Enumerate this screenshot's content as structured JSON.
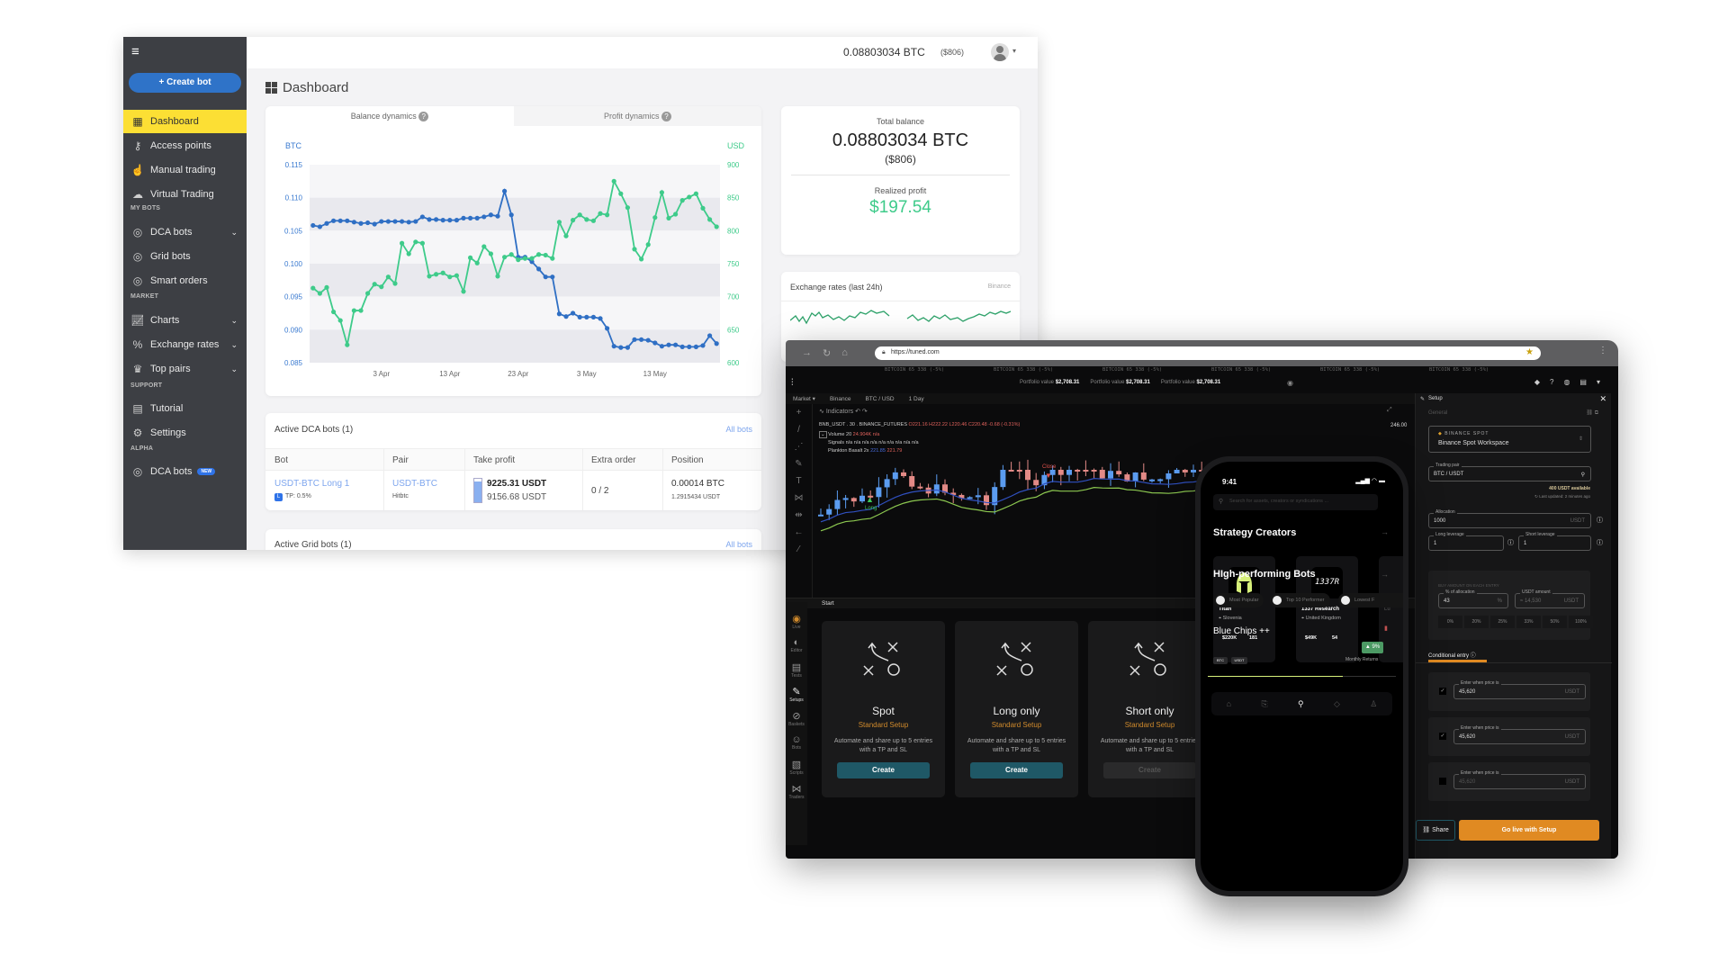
{
  "dashboard": {
    "header": {
      "balance_btc": "0.08803034 BTC",
      "balance_usd": "($806)"
    },
    "sidebar": {
      "create_bot": "Create bot",
      "items": [
        {
          "label": "Dashboard",
          "icon": "grid-icon",
          "active": true
        },
        {
          "label": "Access points",
          "icon": "key-icon"
        },
        {
          "label": "Manual trading",
          "icon": "hand-pointer-icon"
        },
        {
          "label": "Virtual Trading",
          "icon": "cloud-icon"
        },
        {
          "label": "DCA bots",
          "icon": "robot-icon",
          "section": "MY BOTS",
          "dropdown": true
        },
        {
          "label": "Grid bots",
          "icon": "robot-icon"
        },
        {
          "label": "Smart orders",
          "icon": "robot-icon"
        },
        {
          "label": "Charts",
          "icon": "chart-icon",
          "section": "MARKET",
          "dropdown": true
        },
        {
          "label": "Exchange rates",
          "icon": "percent-icon",
          "dropdown": true
        },
        {
          "label": "Top pairs",
          "icon": "trophy-icon",
          "dropdown": true
        },
        {
          "label": "Tutorial",
          "icon": "document-icon",
          "section": "SUPPORT"
        },
        {
          "label": "Settings",
          "icon": "gear-icon"
        },
        {
          "label": "DCA bots",
          "icon": "robot-icon",
          "section": "ALPHA",
          "badge": "NEW"
        }
      ],
      "sections": [
        "MY BOTS",
        "MARKET",
        "SUPPORT",
        "ALPHA"
      ]
    },
    "page_title": "Dashboard",
    "balance_card": {
      "tabs": [
        "Balance dynamics",
        "Profit dynamics"
      ],
      "active_tab": "Balance dynamics",
      "chart_data": {
        "type": "line",
        "left_axis_label": "BTC",
        "right_axis_label": "USD",
        "left_ylim": [
          0.085,
          0.115
        ],
        "right_ylim": [
          600,
          900
        ],
        "left_ticks": [
          "0.115",
          "0.110",
          "0.105",
          "0.100",
          "0.095",
          "0.090",
          "0.085"
        ],
        "right_ticks": [
          "900",
          "850",
          "800",
          "750",
          "700",
          "650",
          "600"
        ],
        "x_ticks": [
          "3 Apr",
          "13 Apr",
          "23 Apr",
          "3 May",
          "13 May"
        ],
        "x": [
          "24 Mar",
          "25 Mar",
          "26 Mar",
          "27 Mar",
          "28 Mar",
          "29 Mar",
          "30 Mar",
          "31 Mar",
          "1 Apr",
          "2 Apr",
          "3 Apr",
          "4 Apr",
          "5 Apr",
          "6 Apr",
          "7 Apr",
          "8 Apr",
          "9 Apr",
          "10 Apr",
          "11 Apr",
          "12 Apr",
          "13 Apr",
          "14 Apr",
          "15 Apr",
          "16 Apr",
          "17 Apr",
          "18 Apr",
          "19 Apr",
          "20 Apr",
          "21 Apr",
          "22 Apr",
          "23 Apr",
          "24 Apr",
          "25 Apr",
          "26 Apr",
          "27 Apr",
          "28 Apr",
          "29 Apr",
          "30 Apr",
          "1 May",
          "2 May",
          "3 May",
          "4 May",
          "5 May",
          "6 May",
          "7 May",
          "8 May",
          "9 May",
          "10 May",
          "11 May",
          "12 May",
          "13 May",
          "14 May",
          "15 May",
          "16 May",
          "17 May",
          "18 May",
          "19 May",
          "20 May",
          "21 May",
          "22 May"
        ],
        "grid": "horizontal bands",
        "series": [
          {
            "axis": "left",
            "color": "#2f6fc4",
            "values": [
              0.1058,
              0.1056,
              0.1061,
              0.1065,
              0.1065,
              0.1065,
              0.1063,
              0.1061,
              0.1062,
              0.106,
              0.1064,
              0.1064,
              0.1064,
              0.1064,
              0.1063,
              0.1064,
              0.1071,
              0.1067,
              0.1067,
              0.1066,
              0.1066,
              0.1066,
              0.1069,
              0.1069,
              0.1069,
              0.1071,
              0.1074,
              0.1072,
              0.111,
              0.1074,
              0.101,
              0.101,
              0.1003,
              0.0992,
              0.098,
              0.098,
              0.0924,
              0.092,
              0.0925,
              0.0919,
              0.0919,
              0.0919,
              0.0917,
              0.0902,
              0.0875,
              0.0873,
              0.0873,
              0.0885,
              0.0885,
              0.0884,
              0.088,
              0.0875,
              0.0877,
              0.0877,
              0.0874,
              0.0874,
              0.0874,
              0.0876,
              0.0891,
              0.0879
            ]
          },
          {
            "axis": "right",
            "color": "#3ecb8a",
            "values": [
              713,
              705,
              714,
              677,
              664,
              627,
              679,
              679,
              705,
              719,
              715,
              730,
              720,
              781,
              765,
              783,
              781,
              731,
              734,
              736,
              730,
              732,
              708,
              759,
              751,
              776,
              765,
              731,
              760,
              764,
              756,
              758,
              758,
              764,
              763,
              758,
              813,
              792,
              816,
              824,
              817,
              815,
              826,
              824,
              875,
              856,
              835,
              772,
              757,
              779,
              820,
              858,
              819,
              825,
              846,
              851,
              856,
              834,
              817,
              806
            ]
          }
        ]
      }
    },
    "total_card": {
      "title": "Total balance",
      "btc": "0.08803034 BTC",
      "usd": "($806)",
      "profit_label": "Realized profit",
      "profit": "$197.54",
      "profit_color": "#3ecb8a"
    },
    "exchange_card": {
      "title": "Exchange rates (last 24h)",
      "source": "Binance"
    },
    "dca_card": {
      "title": "Active DCA bots (1)",
      "all_bots": "All bots",
      "columns": [
        "Bot",
        "Pair",
        "Take profit",
        "Extra order",
        "Position"
      ],
      "row": {
        "bot": "USDT-BTC Long 1",
        "badge": "L",
        "tp": "TP: 0.5%",
        "pair": "USDT-BTC",
        "exchange": "Hitbtc",
        "tp_price": "9225.31 USDT",
        "current": "9156.68 USDT",
        "extra": "0 / 2",
        "position": "0.00014 BTC",
        "position_usdt": "1.2915434 USDT"
      }
    },
    "grid_card": {
      "title": "Active Grid bots (1)",
      "all_bots": "All bots"
    }
  },
  "tablet": {
    "url": "https://tuned.com",
    "ticker": [
      "BITCOIN  65 338 (-5%)",
      "BITCOIN  65 338 (-5%)",
      "BITCOIN  65 338 (-5%)",
      "BITCOIN  65 338 (-5%)",
      "BITCOIN  65 338 (-5%)",
      "BITCOIN  65 338 (-5%)"
    ],
    "portfolio_label": "Portfolio value",
    "portfolio_value": "$2,708.31",
    "toolbar": [
      "Market",
      "Binance",
      "BTC / USD",
      "1 Day"
    ],
    "indicators": "Indicators",
    "legend": {
      "symbol": "BNB_USDT . 30 . BINANCE_FUTURES",
      "ohlc": "O221.16 H222.22 L220.46 C220.48 -0.68 (-0.31%)",
      "volume": "Volume 20",
      "volume_val": "24.904K  n/a",
      "signals": "Signals  n/a n/a n/a n/a n/a n/a n/a n/a n/a",
      "plankton": "Plankton Basalt 2x",
      "p1": "221.85",
      "p2": "221.79"
    },
    "price_label": "246.00",
    "close_label": "Close",
    "long_label": "Long",
    "start": "Start",
    "nav": [
      "Live",
      "Editor",
      "Tests",
      "Setups",
      "Baskets",
      "Bots",
      "Scripts",
      "Traders"
    ],
    "setups": [
      {
        "title": "Spot",
        "sub": "Standard Setup",
        "desc": "Automate and share up to 5 entries with a TP and SL",
        "button": "Create",
        "enabled": true
      },
      {
        "title": "Long only",
        "sub": "Standard Setup",
        "desc": "Automate and share up to 5 entries with a TP and SL",
        "button": "Create",
        "enabled": true
      },
      {
        "title": "Short only",
        "sub": "Standard Setup",
        "desc": "Automate and share up to 5 entries with a TP and SL",
        "button": "Create",
        "enabled": false
      }
    ],
    "setup_panel": {
      "title": "Setup",
      "general": "General",
      "exchange_tag": "BINANCE SPOT",
      "workspace": "Binance Spot Workspace",
      "pair_label": "Trading pair",
      "pair": "BTC / USDT",
      "available": "400 USDT available",
      "updated": "Last updated: 2 minutes ago",
      "allocation_label": "Allocation",
      "allocation": "1000",
      "unit": "USDT",
      "long_label": "Long leverage",
      "long": "1",
      "short_label": "Short leverage",
      "short": "1",
      "buy_title": "BUY AMOUNT ON EACH ENTRY",
      "pct_label": "% of allocation",
      "pct": "43",
      "pct_unit": "%",
      "usdt_label": "USDT amount",
      "usdt": "≈ 14,530",
      "presets": [
        "0%",
        "20%",
        "25%",
        "33%",
        "50%",
        "100%"
      ],
      "conditional": "Conditional entry",
      "entries": [
        {
          "label": "Enter when price is",
          "value": "45,620",
          "checked": true
        },
        {
          "label": "Enter when price is",
          "value": "45,620",
          "checked": true
        },
        {
          "label": "Enter when price is",
          "value": "45,620",
          "checked": false
        }
      ],
      "share": "Share",
      "go_live": "Go live with Setup",
      "accent": "#e08a22"
    }
  },
  "phone": {
    "time": "9:41",
    "search_placeholder": "Search for assets, creators or syndications ...",
    "creators_title": "Strategy Creators",
    "creators": [
      {
        "name": "Titan",
        "country": "Slovenia",
        "aum": "$220K",
        "followers": "181"
      },
      {
        "name": "1337 Research",
        "country": "United Kingdom",
        "aum": "$49K",
        "followers": "54",
        "logo": "1337R"
      },
      {
        "name": "Lu"
      }
    ],
    "bots_title": "HIgh-performing Bots",
    "chips": [
      "Most Popular",
      "Top 10 Performer",
      "Lowest F"
    ],
    "bot": {
      "name": "Blue Chips ++",
      "return": "▲ 9%",
      "return_label": "Monthly Returns",
      "tags": [
        "BTC",
        "USDT"
      ]
    },
    "progress": 0.72
  }
}
